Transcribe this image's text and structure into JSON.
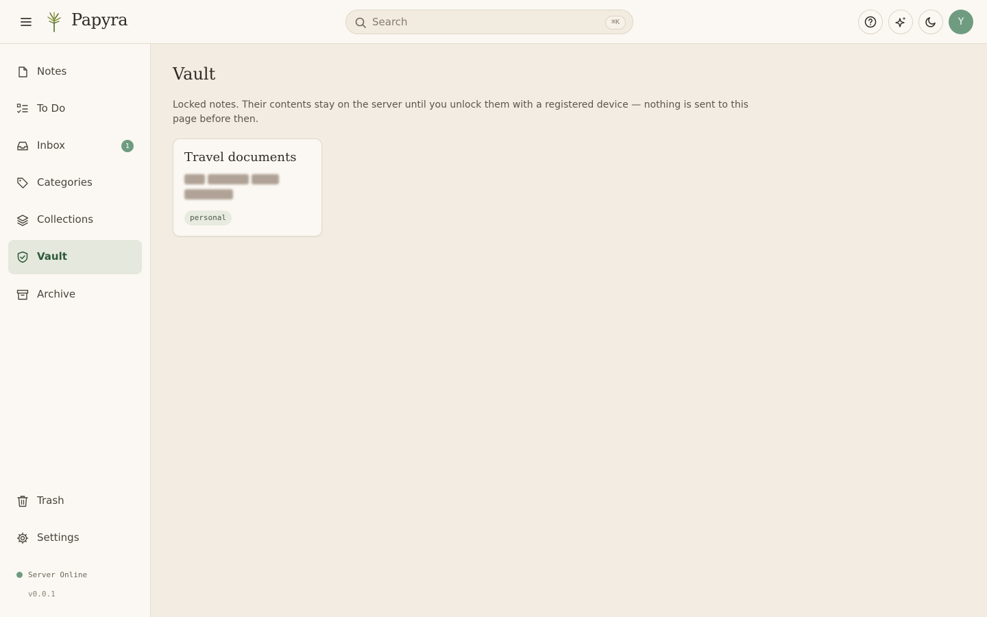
{
  "app": {
    "title": "Papyra"
  },
  "header": {
    "search": {
      "placeholder": "Search",
      "shortcut": "⌘K"
    },
    "avatar_initial": "Y",
    "buttons": [
      "help-icon",
      "sparkles-icon",
      "moon-icon"
    ]
  },
  "sidebar": {
    "items": [
      {
        "label": "Notes",
        "icon": "file-icon"
      },
      {
        "label": "To Do",
        "icon": "checklist-icon"
      },
      {
        "label": "Inbox",
        "icon": "inbox-icon",
        "badge": "1"
      },
      {
        "label": "Categories",
        "icon": "tag-icon"
      },
      {
        "label": "Collections",
        "icon": "layers-icon"
      },
      {
        "label": "Vault",
        "icon": "shield-icon",
        "active": true
      },
      {
        "label": "Archive",
        "icon": "archive-icon"
      }
    ],
    "bottom_items": [
      {
        "label": "Trash",
        "icon": "trash-icon"
      },
      {
        "label": "Settings",
        "icon": "gear-icon"
      }
    ],
    "status": {
      "text": "Server Online",
      "color": "#6f9c80"
    },
    "version": "v0.0.1"
  },
  "main": {
    "title": "Vault",
    "description": "Locked notes. Their contents stay on the server until you unlock them with a registered device — nothing is sent to this page before then.",
    "notes": [
      {
        "title": "Travel documents",
        "tag": "personal",
        "locked": true
      }
    ]
  },
  "colors": {
    "accent": "#6f9c80",
    "active_text": "#2d5a3c",
    "active_bg": "#e5e8dc",
    "page_bg": "#f2ece2",
    "panel_bg": "#fbf8f3"
  }
}
